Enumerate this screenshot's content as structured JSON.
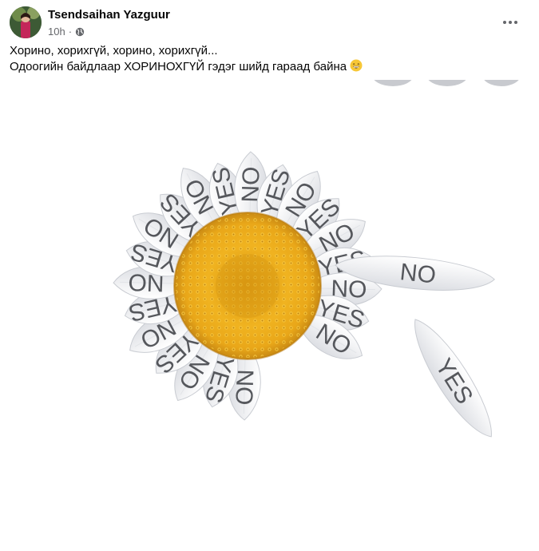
{
  "post": {
    "author": "Tsendsaihan Yazguur",
    "time": "10h",
    "lines": [
      "Хорино, хорихгүй, хорино, хорихгүй...",
      "Одоогийн байдлаар ХОРИНОХГҮЙ гэдэг шийд гараад байна"
    ],
    "emoji": "grinning-face-emoji",
    "privacy_icon": "globe-icon",
    "more_icon": "more-options-icon"
  },
  "image": {
    "petal_labels": [
      "NO",
      "YES",
      "NO",
      "YES",
      "NO",
      "YES",
      "NO",
      "YES",
      "NO",
      "YES",
      "NO",
      "YES",
      "NO",
      "YES",
      "NO",
      "YES",
      "NO",
      "YES",
      "NO",
      "YES",
      "NO"
    ],
    "loose_petals": [
      "NO",
      "YES"
    ],
    "colors": {
      "petal": "#f2f3f5",
      "petal_edge": "#c9ccd2",
      "center": "#e8a817",
      "text": "#55575c"
    }
  }
}
